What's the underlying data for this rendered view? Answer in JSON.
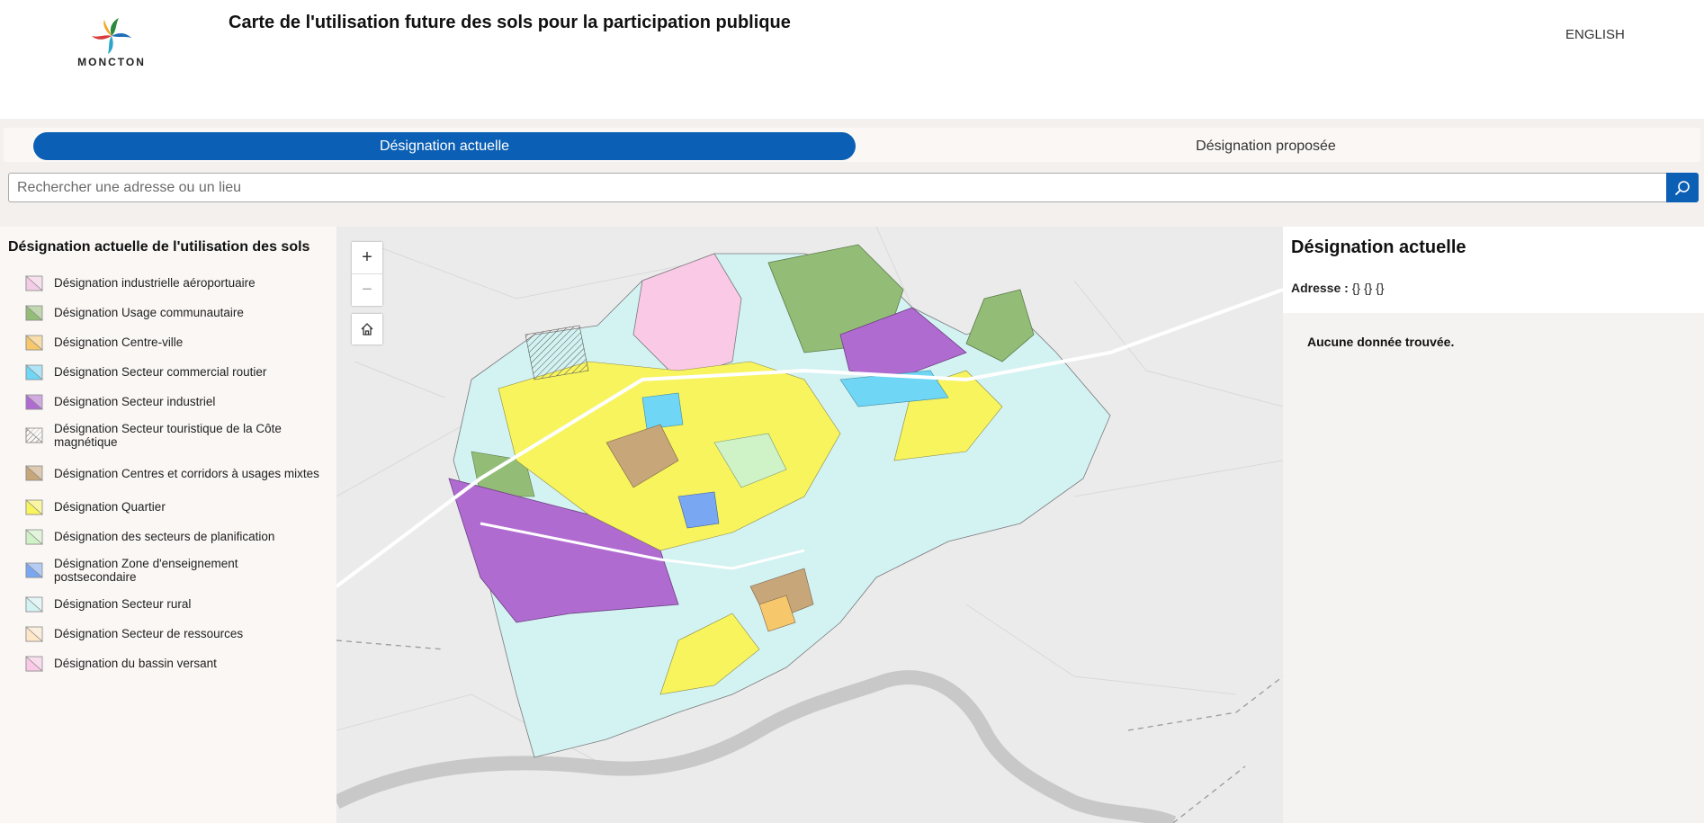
{
  "header": {
    "logo_text": "MONCTON",
    "title": "Carte de l'utilisation future des sols pour la participation publique",
    "language_link": "ENGLISH"
  },
  "tabs": [
    {
      "label": "Désignation actuelle",
      "active": true
    },
    {
      "label": "Désignation proposée",
      "active": false
    }
  ],
  "search": {
    "placeholder": "Rechercher une adresse ou un lieu",
    "value": "",
    "icon": "search-icon"
  },
  "legend": {
    "title": "Désignation actuelle de l'utilisation des sols",
    "items": [
      {
        "label": "Désignation industrielle aéroportuaire",
        "color": "#f3cde6"
      },
      {
        "label": "Désignation Usage communautaire",
        "color": "#93bd77"
      },
      {
        "label": "Désignation Centre-ville",
        "color": "#f6c76b"
      },
      {
        "label": "Désignation Secteur commercial routier",
        "color": "#6fd6f6"
      },
      {
        "label": "Désignation Secteur industriel",
        "color": "#b06bd1"
      },
      {
        "label": "Désignation Secteur touristique de la Côte magnétique",
        "color": "#d9d9d9",
        "pattern": "hatch"
      },
      {
        "label": "Désignation Centres et corridors à usages mixtes",
        "color": "#c7a679"
      },
      {
        "label": "Désignation Quartier",
        "color": "#f7f45e"
      },
      {
        "label": "Désignation des secteurs de planification",
        "color": "#cff2c7"
      },
      {
        "label": "Désignation Zone d'enseignement postsecondaire",
        "color": "#7aa7f2"
      },
      {
        "label": "Désignation Secteur rural",
        "color": "#d3f2f2"
      },
      {
        "label": "Désignation Secteur de ressources",
        "color": "#fde7c7"
      },
      {
        "label": "Désignation du bassin versant",
        "color": "#f9c9e6"
      }
    ]
  },
  "map": {
    "zoom_in": "+",
    "zoom_out": "−",
    "home_icon": "home-icon",
    "basemap_color": "#ebebeb",
    "river_color": "#c8c8c8"
  },
  "panel": {
    "title": "Désignation actuelle",
    "address_label": "Adresse :",
    "address_value": "{} {} {}",
    "empty_message": "Aucune donnée trouvée."
  }
}
